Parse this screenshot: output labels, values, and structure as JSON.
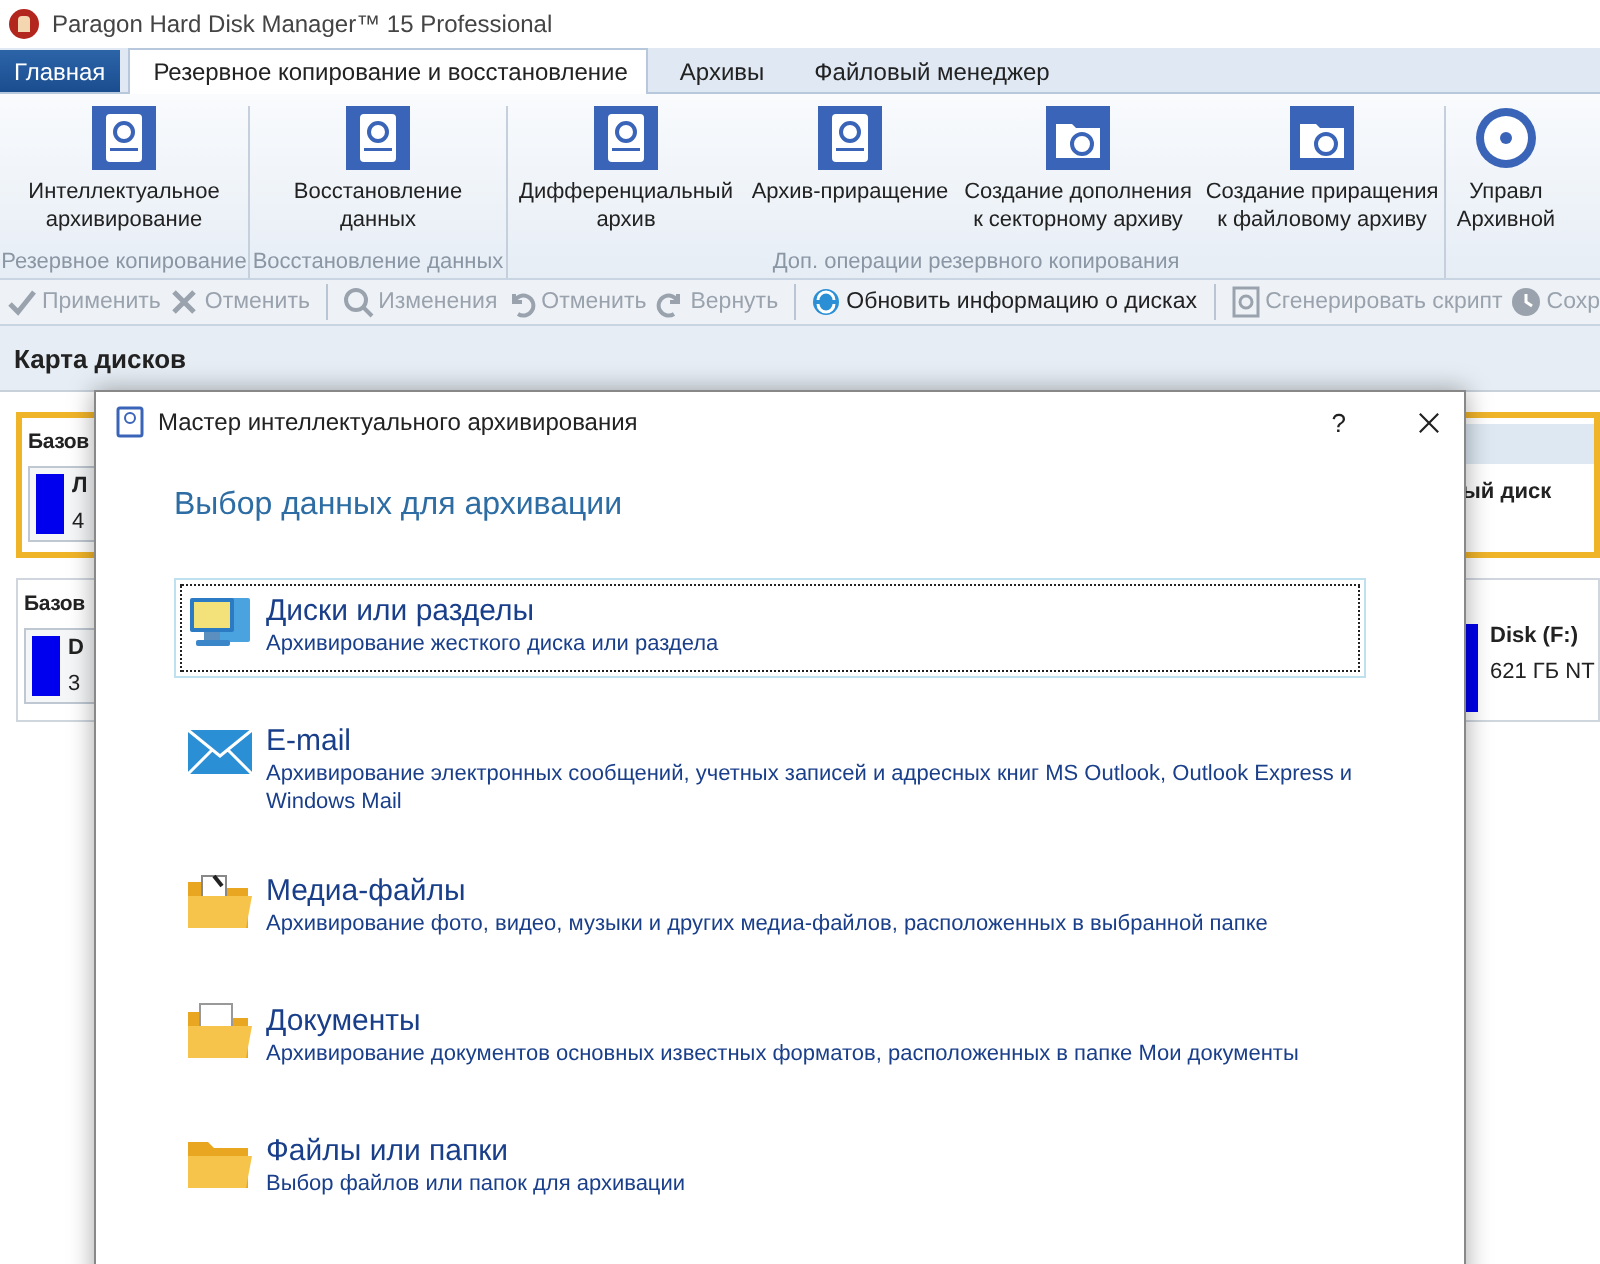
{
  "app_title": "Paragon Hard Disk Manager™ 15 Professional",
  "tabs": [
    {
      "label": "Главная",
      "kind": "menu",
      "selected": false
    },
    {
      "label": "Резервное копирование и восстановление",
      "kind": "tab",
      "selected": true
    },
    {
      "label": "Архивы",
      "kind": "tab",
      "selected": false
    },
    {
      "label": "Файловый менеджер",
      "kind": "tab",
      "selected": false
    }
  ],
  "ribbon": {
    "groups": [
      {
        "label": "Резервное копирование",
        "buttons": [
          {
            "kind": "disk-refresh",
            "lines": [
              "Интеллектуальное",
              "архивирование"
            ]
          }
        ]
      },
      {
        "label": "Восстановление данных",
        "buttons": [
          {
            "kind": "disk-restore",
            "lines": [
              "Восстановление",
              "данных"
            ]
          }
        ]
      },
      {
        "label": "Доп. операции резервного копирования",
        "buttons": [
          {
            "kind": "disk-delta",
            "lines": [
              "Дифференциальный",
              "архив"
            ]
          },
          {
            "kind": "disk-plus",
            "lines": [
              "Архив-приращение"
            ]
          },
          {
            "kind": "folder-delta",
            "lines": [
              "Создание дополнения",
              "к секторному архиву"
            ]
          },
          {
            "kind": "folder-plus",
            "lines": [
              "Создание приращения",
              "к файловому архиву"
            ]
          }
        ]
      },
      {
        "buttons": [
          {
            "kind": "disc",
            "lines": [
              "Управл",
              "Архивной"
            ]
          }
        ]
      }
    ]
  },
  "toolbar": [
    {
      "kind": "check",
      "label": "Применить",
      "disabled": true
    },
    {
      "kind": "cross",
      "label": "Отменить",
      "disabled": true
    },
    {
      "kind": "separator"
    },
    {
      "kind": "magnifier",
      "label": "Изменения",
      "disabled": true
    },
    {
      "kind": "undo",
      "label": "Отменить",
      "disabled": true
    },
    {
      "kind": "redo",
      "label": "Вернуть",
      "disabled": true
    },
    {
      "kind": "separator"
    },
    {
      "kind": "refresh",
      "label": "Обновить информацию о дисках",
      "disabled": false
    },
    {
      "kind": "separator"
    },
    {
      "kind": "script",
      "label": "Сгенерировать скрипт",
      "disabled": true
    },
    {
      "kind": "clock",
      "label": "Сохр",
      "disabled": true
    }
  ],
  "disk_map": {
    "title": "Карта дисков",
    "disks": [
      {
        "selected": true,
        "header": "Базов",
        "partition_name": "Л",
        "partition_size": "4",
        "right_label": "ый диск"
      },
      {
        "selected": false,
        "header": "Базов",
        "partition_name": "D",
        "partition_size": "3",
        "right_partition_name": "Disk (F:)",
        "right_partition_size": "621 ГБ NT"
      }
    ]
  },
  "dialog": {
    "title": "Мастер интеллектуального архивирования",
    "help": "?",
    "heading": "Выбор данных для архивации",
    "options": [
      {
        "kind": "disks",
        "title": "Диски или разделы",
        "description": "Архивирование жесткого диска или раздела",
        "selected": true
      },
      {
        "kind": "email",
        "title": "E-mail",
        "description": "Архивирование электронных сообщений, учетных записей и адресных книг MS Outlook, Outlook Express и Windows Mail",
        "selected": false
      },
      {
        "kind": "media",
        "title": "Медиа-файлы",
        "description": "Архивирование фото, видео, музыки и других медиа-файлов, расположенных в выбранной папке",
        "selected": false
      },
      {
        "kind": "documents",
        "title": "Документы",
        "description": "Архивирование документов основных известных форматов, расположенных в папке Мои документы",
        "selected": false
      },
      {
        "kind": "folders",
        "title": "Файлы или папки",
        "description": "Выбор файлов или папок для архивации",
        "selected": false
      }
    ]
  }
}
